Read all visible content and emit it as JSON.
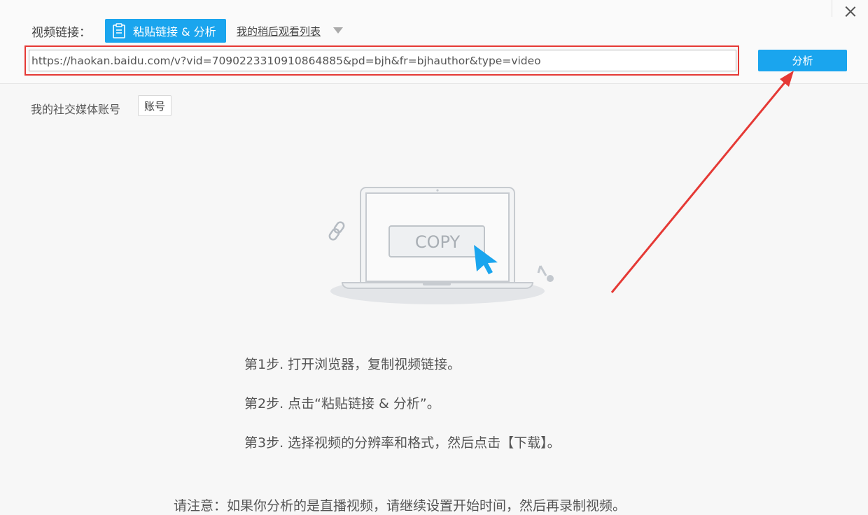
{
  "header": {
    "video_link_label": "视频链接：",
    "paste_button": "粘贴链接 & 分析",
    "watch_later": "我的稍后观看列表",
    "url_value": "https://haokan.baidu.com/v?vid=7090223310910864885&pd=bjh&fr=bjhauthor&type=video",
    "analyze_button": "分析"
  },
  "social": {
    "label": "我的社交媒体账号",
    "account_button": "账号"
  },
  "illustration": {
    "copy_text": "COPY"
  },
  "steps": [
    "第1步. 打开浏览器，复制视频链接。",
    "第2步. 点击“粘贴链接 & 分析”。",
    "第3步. 选择视频的分辨率和格式，然后点击【下载】。"
  ],
  "notice": "请注意：如果你分析的是直播视频，请继续设置开始时间，然后再录制视频。",
  "colors": {
    "accent": "#1aa5ee",
    "highlight_red": "#e53935",
    "background": "#f7f7f7"
  },
  "icons": [
    "clipboard-icon",
    "dropdown-arrow-icon",
    "close-icon",
    "link-icon",
    "cursor-icon",
    "music-note-icon"
  ]
}
